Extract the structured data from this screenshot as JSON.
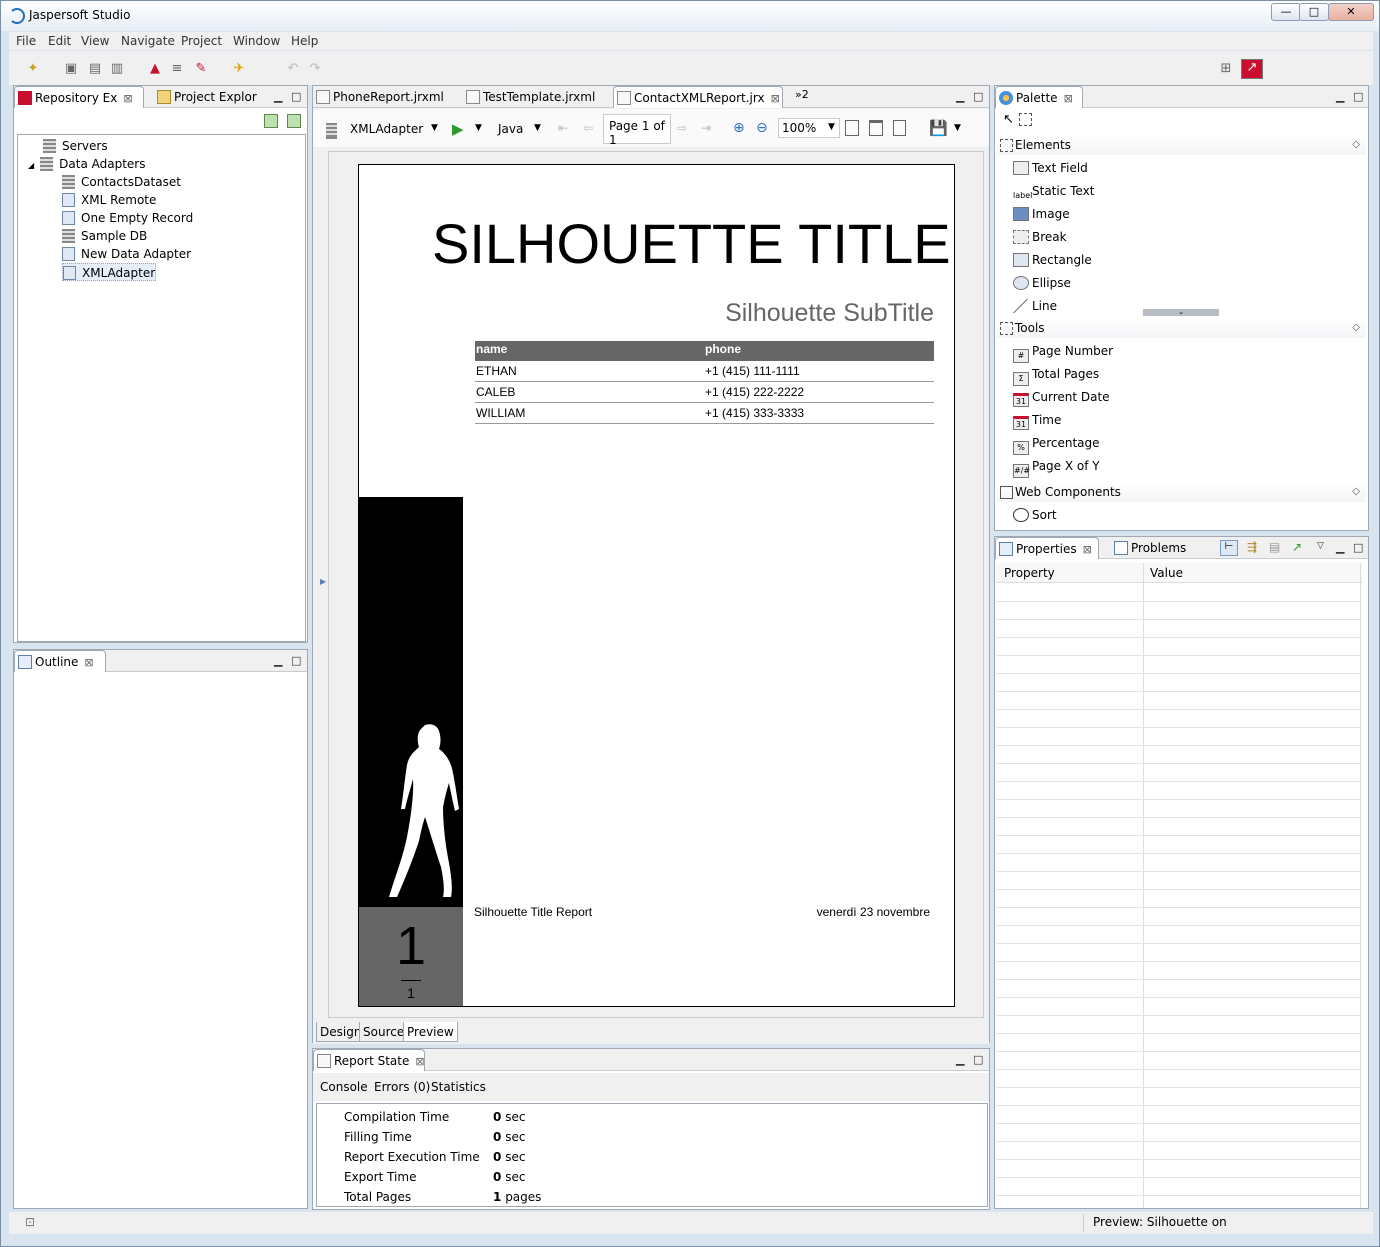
{
  "window": {
    "title": "Jaspersoft Studio",
    "buttons": {
      "minimize": "—",
      "restore": "□",
      "close": "✕"
    }
  },
  "menu": [
    "File",
    "Edit",
    "View",
    "Navigate",
    "Project",
    "Window",
    "Help"
  ],
  "left": {
    "tabs": [
      "Repository Ex",
      "Project Explor"
    ],
    "tree": {
      "servers": "Servers",
      "data_adapters": "Data Adapters",
      "items": [
        "ContactsDataset",
        "XML Remote",
        "One Empty Record",
        "Sample DB",
        "New Data Adapter",
        "XMLAdapter"
      ]
    },
    "outline_tab": "Outline"
  },
  "editor": {
    "tabs": [
      "PhoneReport.jrxml",
      "TestTemplate.jrxml",
      "ContactXMLReport.jrx"
    ],
    "overflow": "»2",
    "toolbar": {
      "adapter": "XMLAdapter",
      "language": "Java",
      "page": "Page 1 of 1",
      "zoom": "100%"
    },
    "report": {
      "title": "SILHOUETTE TITLE",
      "subtitle": "Silhouette SubTitle",
      "columns": [
        "name",
        "phone"
      ],
      "rows": [
        [
          "ETHAN",
          "+1 (415) 111-1111"
        ],
        [
          "CALEB",
          "+1 (415) 222-2222"
        ],
        [
          "WILLIAM",
          "+1 (415) 333-3333"
        ]
      ],
      "footer_left": "Silhouette Title Report",
      "footer_right": "venerdì 23 novembre",
      "page_number": "1",
      "total_pages": "1"
    },
    "bottom_tabs": [
      "Design",
      "Source",
      "Preview"
    ]
  },
  "report_state": {
    "tab": "Report State",
    "subtabs": [
      "Console",
      "Errors (0)",
      "Statistics"
    ],
    "stats": [
      {
        "label": "Compilation Time",
        "value": "0",
        "unit": "sec"
      },
      {
        "label": "Filling Time",
        "value": "0",
        "unit": "sec"
      },
      {
        "label": "Report Execution Time",
        "value": "0",
        "unit": "sec"
      },
      {
        "label": "Export Time",
        "value": "0",
        "unit": "sec"
      },
      {
        "label": "Total Pages",
        "value": "1",
        "unit": "pages"
      }
    ]
  },
  "palette": {
    "tab": "Palette",
    "sections": {
      "elements": "Elements",
      "tools": "Tools",
      "web": "Web Components"
    },
    "elements": [
      {
        "label": "Text Field",
        "icon": ""
      },
      {
        "label": "Static Text",
        "icon": "label"
      },
      {
        "label": "Image",
        "icon": ""
      },
      {
        "label": "Break",
        "icon": ""
      },
      {
        "label": "Rectangle",
        "icon": ""
      },
      {
        "label": "Ellipse",
        "icon": ""
      },
      {
        "label": "Line",
        "icon": ""
      }
    ],
    "tools": [
      {
        "label": "Page Number",
        "icon": "#"
      },
      {
        "label": "Total Pages",
        "icon": "Σ"
      },
      {
        "label": "Current Date",
        "icon": "31"
      },
      {
        "label": "Time",
        "icon": "31"
      },
      {
        "label": "Percentage",
        "icon": "%"
      },
      {
        "label": "Page X of Y",
        "icon": "#/#"
      }
    ],
    "web": [
      {
        "label": "Sort",
        "icon": ""
      }
    ]
  },
  "properties": {
    "tabs": [
      "Properties",
      "Problems"
    ],
    "columns": [
      "Property",
      "Value"
    ]
  },
  "status": {
    "text": "Preview: Silhouette on"
  },
  "colors": {
    "accent": "#c8102e",
    "header_gray": "#666666",
    "chrome": "#f0f0f0"
  }
}
